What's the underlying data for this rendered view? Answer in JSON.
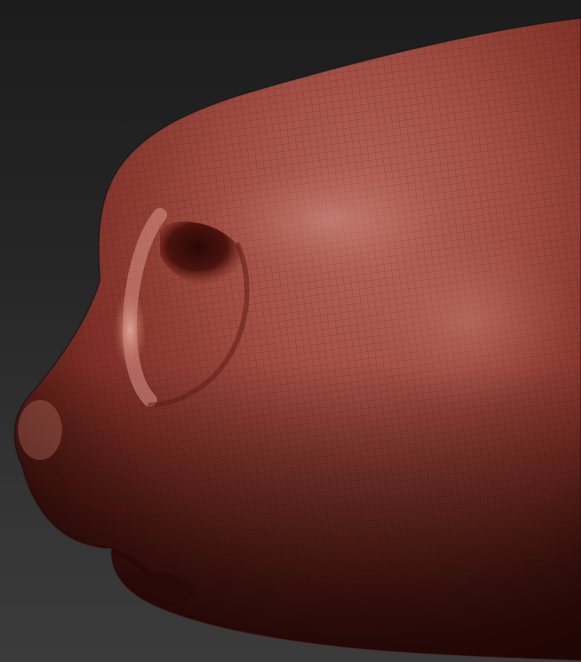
{
  "scene": {
    "subject": "sculpt-nose-mouth-profile",
    "colors": {
      "background_top": "#1c1c1c",
      "background_bottom": "#3b3b3b",
      "clay_base": "#9a3f35",
      "clay_highlight": "#c97a6e",
      "clay_shadow": "#3a0f0b",
      "wire_line": "#5a1f18"
    }
  }
}
